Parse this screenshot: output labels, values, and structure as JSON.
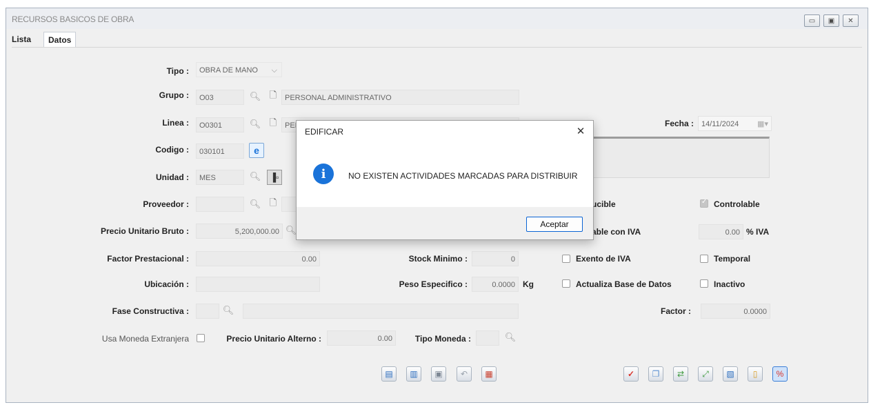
{
  "window": {
    "title": "RECURSOS BASICOS DE OBRA",
    "controls": {
      "minimize": "▭",
      "restore": "▣",
      "close": "✕"
    }
  },
  "tabs": [
    {
      "label": "Lista"
    },
    {
      "label": "Datos"
    }
  ],
  "form": {
    "tipo": {
      "label": "Tipo :",
      "value": "OBRA DE MANO",
      "icon": "chevron-down-icon"
    },
    "grupo": {
      "label": "Grupo :",
      "code": "O03",
      "desc": "PERSONAL ADMINISTRATIVO"
    },
    "linea": {
      "label": "Linea :",
      "code": "O0301",
      "desc": "PER"
    },
    "codigo": {
      "label": "Codigo :",
      "value": "030101"
    },
    "unidad": {
      "label": "Unidad :",
      "value": "MES"
    },
    "proveedor": {
      "label": "Proveedor :"
    },
    "precio_bruto": {
      "label": "Precio Unitario Bruto :",
      "value": "5,200,000.00"
    },
    "factor_prest": {
      "label": "Factor Prestacional :",
      "value": "0.00"
    },
    "ubicacion": {
      "label": "Ubicación :"
    },
    "fase": {
      "label": "Fase Constructiva :"
    },
    "usa_moneda": {
      "label": "Usa Moneda Extranjera"
    },
    "precio_alterno": {
      "label": "Precio Unitario Alterno :",
      "value": "0.00"
    },
    "tipo_moneda": {
      "label": "Tipo Moneda :"
    },
    "stock_minimo": {
      "label": "Stock Minimo :",
      "value": "0"
    },
    "peso_especifico": {
      "label": "Peso Especifico :",
      "value": "0.0000",
      "unit": "Kg"
    },
    "fecha": {
      "label": "Fecha :",
      "value": "14/11/2024"
    },
    "deducible": {
      "label": "ucible"
    },
    "controlable": {
      "label": "Controlable"
    },
    "gravable": {
      "label": "able con IVA"
    },
    "iva": {
      "value": "0.00",
      "label": "% IVA"
    },
    "exento": {
      "label": "Exento de IVA"
    },
    "temporal": {
      "label": "Temporal"
    },
    "actualiza": {
      "label": "Actualiza Base de Datos"
    },
    "inactivo": {
      "label": "Inactivo"
    },
    "factor": {
      "label": "Factor :",
      "value": "0.0000"
    }
  },
  "dialog": {
    "title": "EDIFICAR",
    "close": "✕",
    "icon": "info-icon",
    "info_glyph": "i",
    "message": "NO EXISTEN ACTIVIDADES MARCADAS PARA DISTRIBUIR",
    "button": "Aceptar"
  },
  "toolbar_left": [
    "new-icon",
    "edit-icon",
    "save-icon",
    "undo-icon",
    "report-icon"
  ],
  "toolbar_right": [
    "check-icon",
    "copy-icon",
    "refresh-icon",
    "expand-icon",
    "delete-icon",
    "clipboard-icon",
    "exit-icon"
  ],
  "colors": {
    "accent": "#1a73d9",
    "button_border": "#0a64d4",
    "check": "#d9342b"
  }
}
